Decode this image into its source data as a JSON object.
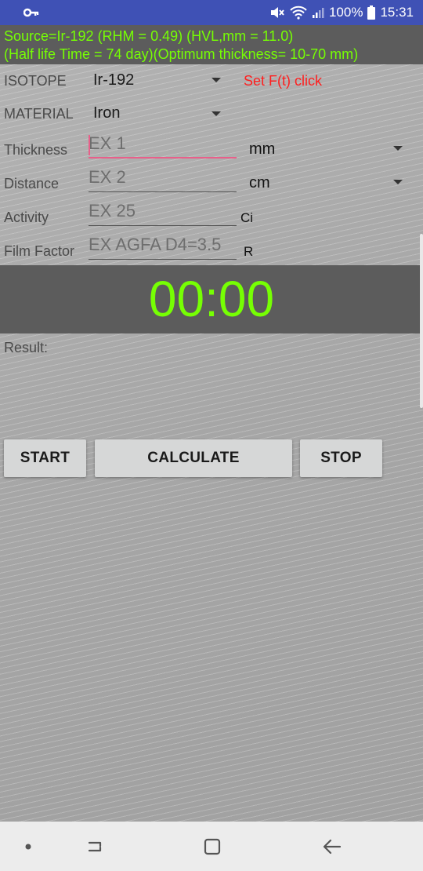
{
  "status_bar": {
    "battery": "100%",
    "time": "15:31",
    "icons": [
      "key-icon",
      "mute-icon",
      "wifi-icon",
      "signal-icon",
      "battery-icon"
    ]
  },
  "info": {
    "line1": "Source=Ir-192  (RHM = 0.49)  (HVL,mm = 11.0)",
    "line2": "(Half life Time = 74 day)(Optimum thickness= 10-70 mm)"
  },
  "form": {
    "isotope_label": "ISOTOPE",
    "isotope_value": "Ir-192",
    "set_ft_label": "Set F(t) click",
    "material_label": "MATERIAL",
    "material_value": "Iron",
    "thickness_label": "Thickness",
    "thickness_placeholder": "EX 1",
    "thickness_unit": "mm",
    "distance_label": "Distance",
    "distance_placeholder": "EX 2",
    "distance_unit": "cm",
    "activity_label": "Activity",
    "activity_placeholder": "EX 25",
    "activity_unit": "Ci",
    "film_label": "Film Factor",
    "film_placeholder": "EX AGFA D4=3.5",
    "film_unit": "R"
  },
  "timer": "00:00",
  "result_label": "Result:",
  "buttons": {
    "start": "START",
    "calculate": "CALCULATE",
    "stop": "STOP"
  },
  "colors": {
    "status_bar": "#3f51b5",
    "header_bg": "#5c5c5c",
    "accent_green": "#76ff03",
    "set_ft_red": "#ff1e1e",
    "focus_pink": "#e8608a"
  }
}
